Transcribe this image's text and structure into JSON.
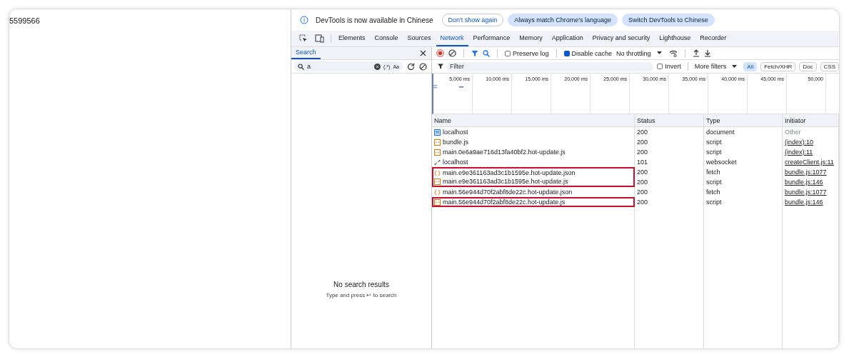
{
  "page": {
    "text": "5599566"
  },
  "infobar": {
    "message": "DevTools is now available in Chinese",
    "buttons": [
      {
        "label": "Don't show again",
        "kind": "outline"
      },
      {
        "label": "Always match Chrome's language",
        "kind": "filled"
      },
      {
        "label": "Switch DevTools to Chinese",
        "kind": "filled"
      }
    ]
  },
  "tabs": [
    {
      "label": "Elements",
      "selected": false
    },
    {
      "label": "Console",
      "selected": false
    },
    {
      "label": "Sources",
      "selected": false
    },
    {
      "label": "Network",
      "selected": true
    },
    {
      "label": "Performance",
      "selected": false
    },
    {
      "label": "Memory",
      "selected": false
    },
    {
      "label": "Application",
      "selected": false
    },
    {
      "label": "Privacy and security",
      "selected": false
    },
    {
      "label": "Lighthouse",
      "selected": false
    },
    {
      "label": "Recorder",
      "selected": false
    }
  ],
  "search_panel": {
    "title": "Search",
    "query": "a",
    "regex_label": "(.*)",
    "case_label": "Aa",
    "empty_title": "No search results",
    "empty_hint": "Type and press ↩ to search"
  },
  "toolbar": {
    "recording": true,
    "preserve_log": {
      "label": "Preserve log",
      "checked": false
    },
    "disable_cache": {
      "label": "Disable cache",
      "checked": true
    },
    "throttling": "No throttling"
  },
  "filter_bar": {
    "placeholder": "Filter",
    "invert": {
      "label": "Invert",
      "checked": false
    },
    "more_filters": "More filters",
    "types": [
      {
        "label": "All",
        "selected": true
      },
      {
        "label": "Fetch/XHR",
        "selected": false
      },
      {
        "label": "Doc",
        "selected": false
      },
      {
        "label": "CSS",
        "selected": false
      }
    ]
  },
  "timeline": {
    "ticks": [
      "5,000 ms",
      "10,000 ms",
      "15,000 ms",
      "20,000 ms",
      "25,000 ms",
      "30,000 ms",
      "35,000 ms",
      "40,000 ms",
      "45,000 ms",
      "50,000"
    ]
  },
  "table": {
    "columns": [
      "Name",
      "Status",
      "Type",
      "Initiator"
    ],
    "rows": [
      {
        "name": "localhost",
        "status": "200",
        "type": "document",
        "initiator": "Other",
        "kind": "document",
        "link": false,
        "highlight": false
      },
      {
        "name": "bundle.js",
        "status": "200",
        "type": "script",
        "initiator": "(index):10",
        "kind": "script",
        "link": true,
        "highlight": false
      },
      {
        "name": "main.0e6a9ae716d13fa40bf2.hot-update.js",
        "status": "200",
        "type": "script",
        "initiator": "(index):11",
        "kind": "script",
        "link": true,
        "highlight": false
      },
      {
        "name": "localhost",
        "status": "101",
        "type": "websocket",
        "initiator": "createClient.js:11",
        "kind": "websocket",
        "link": true,
        "highlight": false
      },
      {
        "name": "main.e9e361163ad3c1b1595e.hot-update.json",
        "status": "200",
        "type": "fetch",
        "initiator": "bundle.js:1077",
        "kind": "fetch",
        "link": true,
        "highlight": true
      },
      {
        "name": "main.e9e361163ad3c1b1595e.hot-update.js",
        "status": "200",
        "type": "script",
        "initiator": "bundle.js:146",
        "kind": "script",
        "link": true,
        "highlight": true
      },
      {
        "name": "main.56e944d70f2abf8de22c.hot-update.json",
        "status": "200",
        "type": "fetch",
        "initiator": "bundle.js:1077",
        "kind": "fetch",
        "link": true,
        "highlight": false
      },
      {
        "name": "main.56e944d70f2abf8de22c.hot-update.js",
        "status": "200",
        "type": "script",
        "initiator": "bundle.js:146",
        "kind": "script",
        "link": true,
        "highlight": true
      }
    ]
  }
}
